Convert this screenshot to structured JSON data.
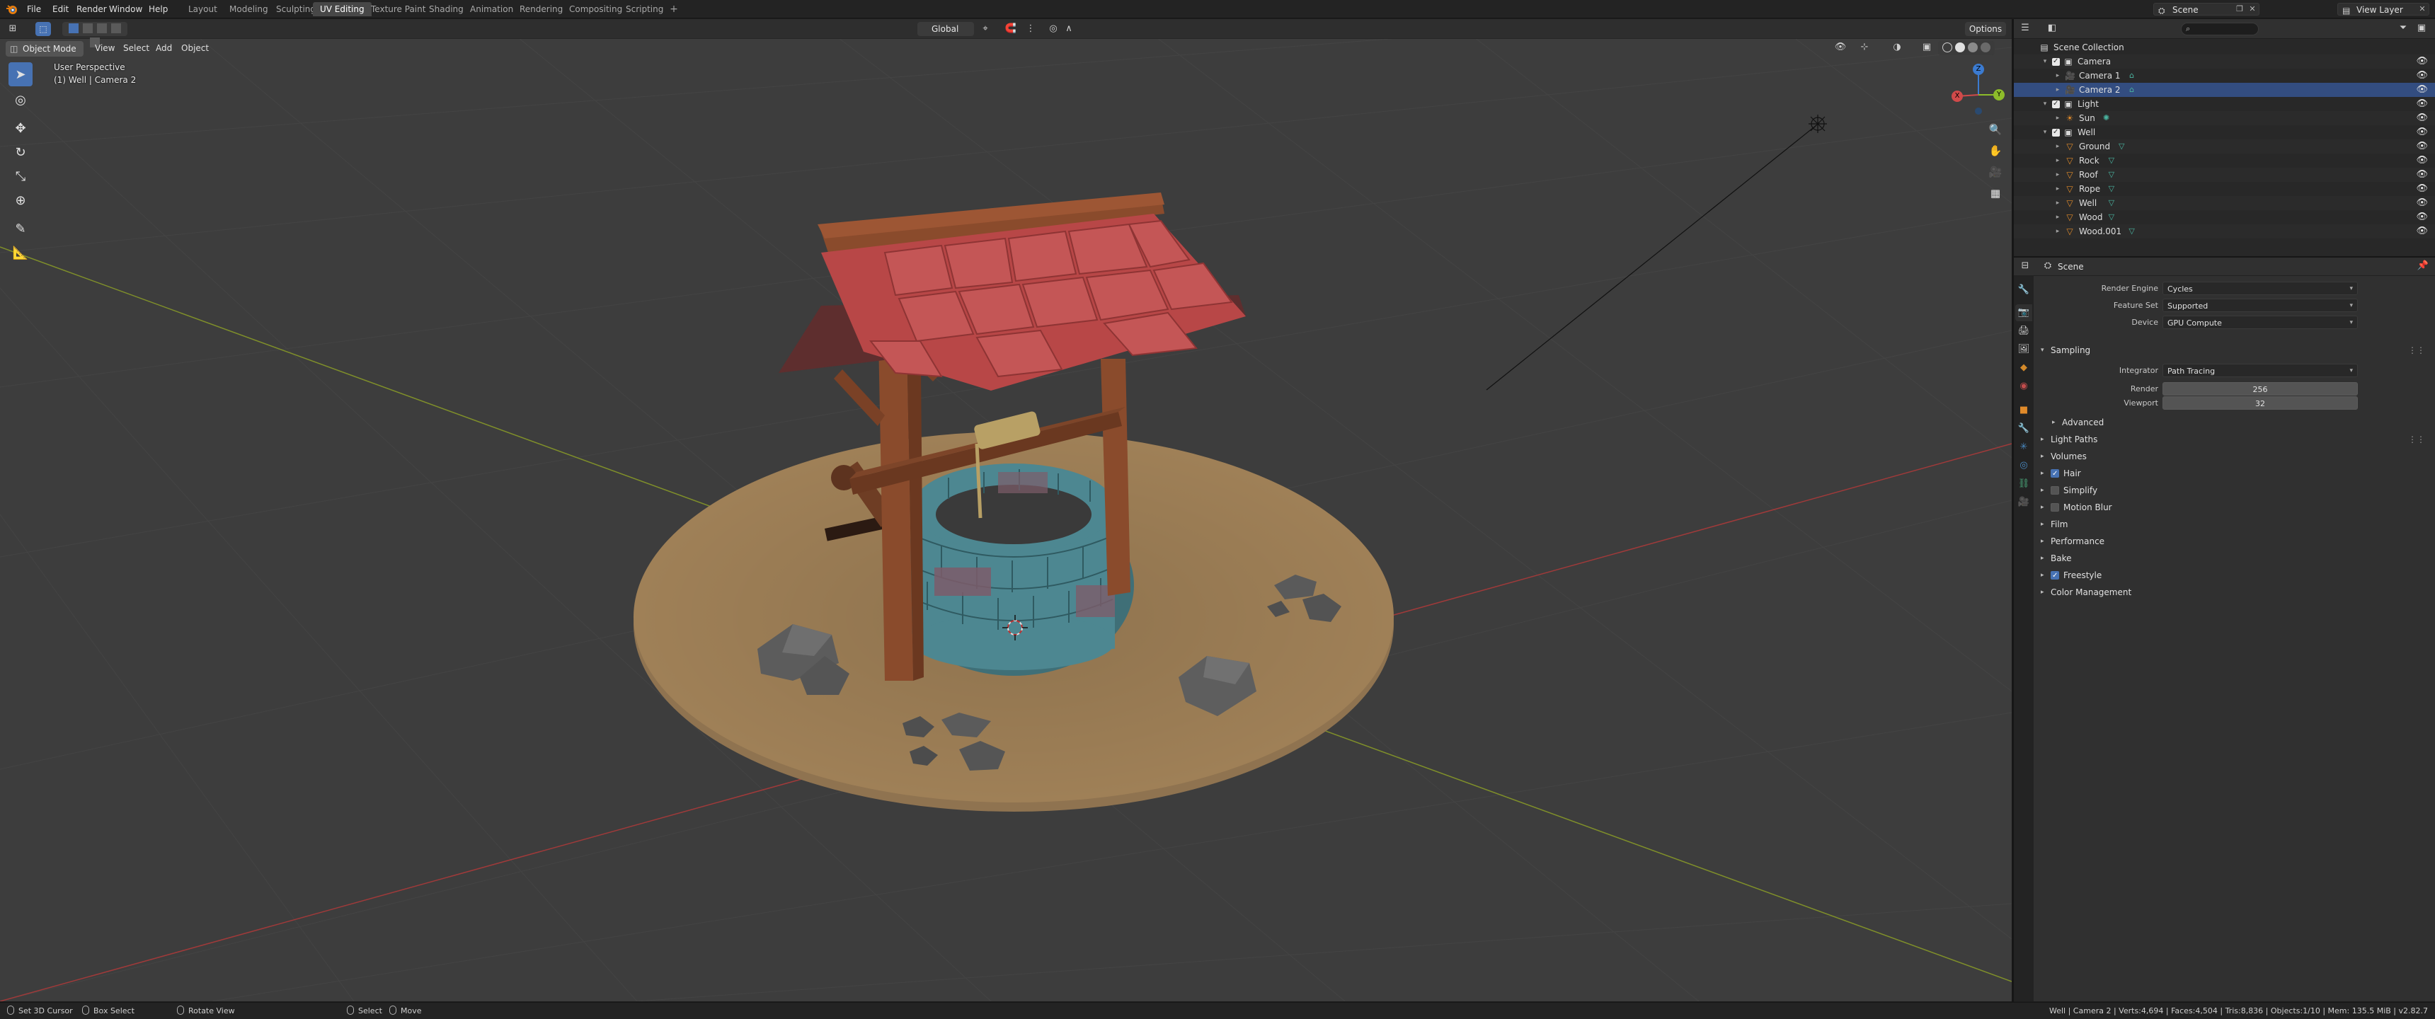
{
  "app": {
    "logo": "blender-logo-icon"
  },
  "menu": [
    "File",
    "Edit",
    "Render",
    "Window",
    "Help"
  ],
  "workspaces": {
    "tabs": [
      "Layout",
      "Modeling",
      "Sculpting",
      "UV Editing",
      "Texture Paint",
      "Shading",
      "Animation",
      "Rendering",
      "Compositing",
      "Scripting"
    ],
    "active": "UV Editing"
  },
  "scene_selector": {
    "value": "Scene"
  },
  "view_layer_selector": {
    "value": "View Layer"
  },
  "viewport": {
    "transform_orientation": "Global",
    "options_label": "Options",
    "mode": "Object Mode",
    "menus": [
      "View",
      "Select",
      "Add",
      "Object"
    ],
    "perspective_label": "User Perspective",
    "object_label": "(1) Well | Camera 2",
    "gizmo_axes": {
      "x": "X",
      "y": "Y",
      "z": "Z"
    },
    "colors": {
      "background": "#3d3d3d",
      "x_axis": "#a03a3a",
      "y_axis": "#7f8f2a",
      "roof": "#b84747",
      "wood": "#8a4b2c",
      "stone": "#4d8791",
      "ground": "#9f8057",
      "rock": "#5c5c5c"
    }
  },
  "outliner": {
    "search_placeholder": "",
    "rows": [
      {
        "name": "Scene Collection",
        "type": "scene-collection-icon",
        "depth": 0
      },
      {
        "name": "Camera",
        "type": "collection-icon",
        "depth": 1,
        "checked": true,
        "expanded": true
      },
      {
        "name": "Camera 1",
        "type": "camera-object-icon",
        "depth": 2
      },
      {
        "name": "Camera 2",
        "type": "camera-object-icon",
        "depth": 2,
        "selected": true
      },
      {
        "name": "Light",
        "type": "collection-icon",
        "depth": 1,
        "checked": true,
        "expanded": true
      },
      {
        "name": "Sun",
        "type": "light-object-icon",
        "depth": 2
      },
      {
        "name": "Well",
        "type": "collection-icon",
        "depth": 1,
        "checked": true,
        "expanded": true
      },
      {
        "name": "Ground",
        "type": "mesh-object-icon",
        "depth": 2
      },
      {
        "name": "Rock",
        "type": "mesh-object-icon",
        "depth": 2
      },
      {
        "name": "Roof",
        "type": "mesh-object-icon",
        "depth": 2
      },
      {
        "name": "Rope",
        "type": "mesh-object-icon",
        "depth": 2
      },
      {
        "name": "Well",
        "type": "mesh-object-icon",
        "depth": 2
      },
      {
        "name": "Wood",
        "type": "mesh-object-icon",
        "depth": 2
      },
      {
        "name": "Wood.001",
        "type": "mesh-object-icon",
        "depth": 2
      }
    ]
  },
  "properties": {
    "context": "Scene",
    "render_engine": {
      "label": "Render Engine",
      "value": "Cycles"
    },
    "feature_set": {
      "label": "Feature Set",
      "value": "Supported"
    },
    "device": {
      "label": "Device",
      "value": "GPU Compute"
    },
    "sampling": {
      "title": "Sampling",
      "integrator": {
        "label": "Integrator",
        "value": "Path Tracing"
      },
      "render": {
        "label": "Render",
        "value": "256"
      },
      "viewport": {
        "label": "Viewport",
        "value": "32"
      },
      "advanced": "Advanced"
    },
    "panels": {
      "light_paths": "Light Paths",
      "volumes": "Volumes",
      "hair": "Hair",
      "simplify": "Simplify",
      "motion_blur": "Motion Blur",
      "film": "Film",
      "performance": "Performance",
      "bake": "Bake",
      "freestyle": "Freestyle",
      "color_management": "Color Management"
    }
  },
  "statusbar": {
    "items": [
      "Set 3D Cursor",
      "Box Select",
      "Rotate View",
      "Select",
      "Move"
    ],
    "stats": "Well | Camera 2 | Verts:4,694 | Faces:4,504 | Tris:8,836 | Objects:1/10 | Mem: 135.5 MiB | v2.82.7"
  }
}
